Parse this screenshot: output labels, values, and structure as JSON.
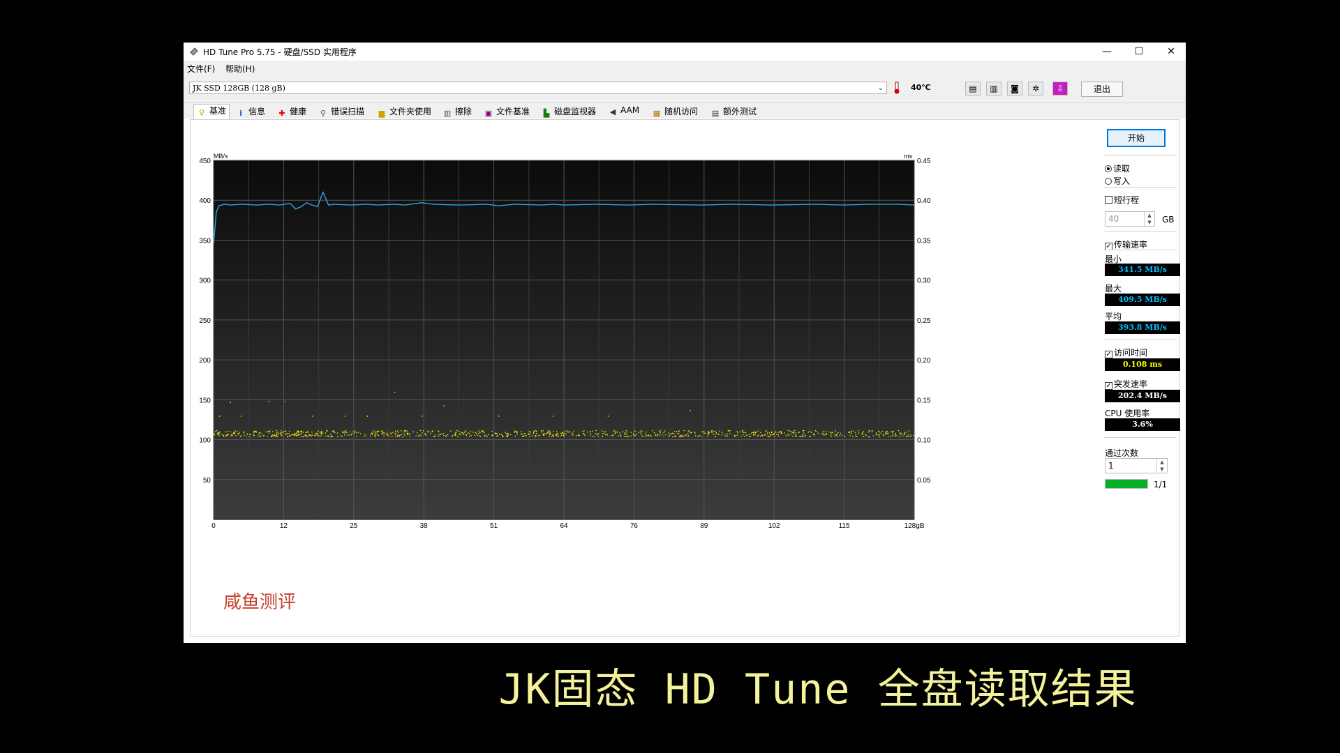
{
  "window": {
    "title": "HD Tune Pro 5.75 - 硬盘/SSD 实用程序",
    "controls": {
      "minimize": "—",
      "maximize": "☐",
      "close": "✕"
    }
  },
  "menu": {
    "file": "文件(F)",
    "help": "帮助(H)"
  },
  "toolbar": {
    "drive": "JK SSD 128GB (128 gB)",
    "temperature": "40℃",
    "exit": "退出"
  },
  "tabs": [
    {
      "label": "基准",
      "icon": "benchmark-icon"
    },
    {
      "label": "信息",
      "icon": "info-icon"
    },
    {
      "label": "健康",
      "icon": "health-icon"
    },
    {
      "label": "错误扫描",
      "icon": "error-scan-icon"
    },
    {
      "label": "文件夹使用",
      "icon": "folder-icon"
    },
    {
      "label": "擦除",
      "icon": "erase-icon"
    },
    {
      "label": "文件基准",
      "icon": "file-benchmark-icon"
    },
    {
      "label": "磁盘监视器",
      "icon": "disk-monitor-icon"
    },
    {
      "label": "AAM",
      "icon": "speaker-icon"
    },
    {
      "label": "随机访问",
      "icon": "random-access-icon"
    },
    {
      "label": "额外测试",
      "icon": "extra-tests-icon"
    }
  ],
  "side": {
    "start": "开始",
    "read": "读取",
    "write": "写入",
    "short_stroke": "短行程",
    "short_stroke_value": "40",
    "short_stroke_unit": "GB",
    "transfer_rate": "传输速率",
    "min_label": "最小",
    "min_value": "341.5 MB/s",
    "max_label": "最大",
    "max_value": "409.5 MB/s",
    "avg_label": "平均",
    "avg_value": "393.8 MB/s",
    "access_time": "访问时间",
    "access_value": "0.108 ms",
    "burst_rate": "突发速率",
    "burst_value": "202.4 MB/s",
    "cpu_label": "CPU 使用率",
    "cpu_value": "3.6%",
    "passes_label": "通过次数",
    "passes_value": "1",
    "progress_text": "1/1",
    "progress": 1.0,
    "colors": {
      "transfer": "#00bfff",
      "access": "#ffff00",
      "burst": "#ffffff"
    }
  },
  "chart_data": {
    "type": "line",
    "left_unit": "MB/s",
    "right_unit": "ms",
    "x_ticks": [
      "0",
      "12",
      "25",
      "38",
      "51",
      "64",
      "76",
      "89",
      "102",
      "115",
      "128gB"
    ],
    "y_ticks": [
      50,
      100,
      150,
      200,
      250,
      300,
      350,
      400,
      450
    ],
    "y2_ticks": [
      "0.05",
      "0.10",
      "0.15",
      "0.20",
      "0.25",
      "0.30",
      "0.35",
      "0.40",
      "0.45"
    ],
    "ylim": [
      0,
      450
    ],
    "y2lim": [
      0,
      0.45
    ],
    "xlim": [
      0,
      128
    ],
    "series": [
      {
        "color": "#2aa7e6",
        "x": [
          0,
          0.5,
          1,
          2,
          3,
          5,
          8,
          10,
          12,
          14,
          15,
          16,
          17,
          18,
          19,
          20,
          21,
          22,
          25,
          28,
          30,
          33,
          35,
          38,
          40,
          45,
          50,
          52,
          55,
          60,
          62,
          64,
          70,
          76,
          80,
          89,
          95,
          102,
          110,
          115,
          120,
          125,
          128
        ],
        "y": [
          345,
          385,
          393,
          395,
          394,
          395,
          394,
          395,
          394,
          396,
          389,
          392,
          397,
          394,
          392,
          410,
          394,
          395,
          394,
          395,
          394,
          395,
          394,
          397,
          395,
          394,
          395,
          393,
          395,
          394,
          395,
          394,
          395,
          394,
          395,
          394,
          395,
          394,
          395,
          394,
          395,
          395,
          394
        ]
      }
    ],
    "access_points_ms": {
      "color": "#ffff00",
      "band_low": 0.104,
      "band_high": 0.112,
      "outliers": [
        [
          1,
          0.13
        ],
        [
          3,
          0.147
        ],
        [
          5,
          0.13
        ],
        [
          10,
          0.148
        ],
        [
          13,
          0.148
        ],
        [
          18,
          0.13
        ],
        [
          24,
          0.13
        ],
        [
          28,
          0.13
        ],
        [
          33,
          0.16
        ],
        [
          38,
          0.13
        ],
        [
          42,
          0.143
        ],
        [
          52,
          0.13
        ],
        [
          62,
          0.13
        ],
        [
          72,
          0.13
        ],
        [
          87,
          0.137
        ]
      ]
    },
    "watermark": "咸鱼测评"
  },
  "caption": "JK固态 HD Tune 全盘读取结果"
}
